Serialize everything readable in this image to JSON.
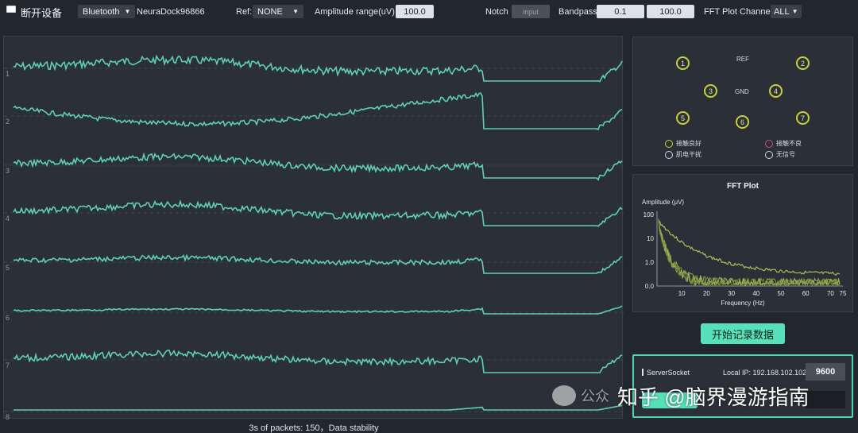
{
  "toolbar": {
    "disconnect_label": "断开设备",
    "connection_type": "Bluetooth",
    "device_name": "NeuraDock96866",
    "ref_label": "Ref:",
    "ref_value": "NONE",
    "amplitude_label": "Amplitude range(uV)",
    "amplitude_value": "100.0",
    "notch_label": "Notch",
    "notch_placeholder": "input",
    "bandpass_label": "Bandpass",
    "bandpass_low": "0.1",
    "bandpass_high": "100.0",
    "fft_channel_label": "FFT Plot Channel:",
    "fft_channel_value": "ALL"
  },
  "channels": [
    "1",
    "2",
    "3",
    "4",
    "5",
    "6",
    "7",
    "8"
  ],
  "status": "3s of packets: 150，Data stability",
  "electrodes": {
    "ref_label": "REF",
    "gnd_label": "GND",
    "points": [
      "1",
      "2",
      "3",
      "4",
      "5",
      "6",
      "7"
    ]
  },
  "legend": {
    "good": "接触良好",
    "bad": "接触不良",
    "emg": "肌电干扰",
    "no_signal": "无信号",
    "good_color": "#c9cf3a",
    "bad_color": "#d24b7a",
    "neutral_color": "#cfd4d9"
  },
  "fft": {
    "title": "FFT Plot",
    "ylabel": "Amplitude (μV)",
    "xlabel": "Frequency (Hz)",
    "yticks": [
      "100",
      "10",
      "1.0",
      "0.0"
    ],
    "xticks": [
      "10",
      "20",
      "30",
      "40",
      "50",
      "60",
      "70",
      "75"
    ]
  },
  "record_button": "开始记录数据",
  "socket": {
    "label": "ServerSocket",
    "local_ip_label": "Local IP: 192.168.102.102",
    "port": "9600"
  },
  "watermark": {
    "prefix": "公众",
    "text": "知乎 @脑界漫游指南"
  },
  "colors": {
    "trace": "#5fd0b0",
    "fft_trace": "#a8c24a",
    "accent": "#58e0b9",
    "panel_bg": "#2b3038",
    "app_bg": "#22272e"
  }
}
